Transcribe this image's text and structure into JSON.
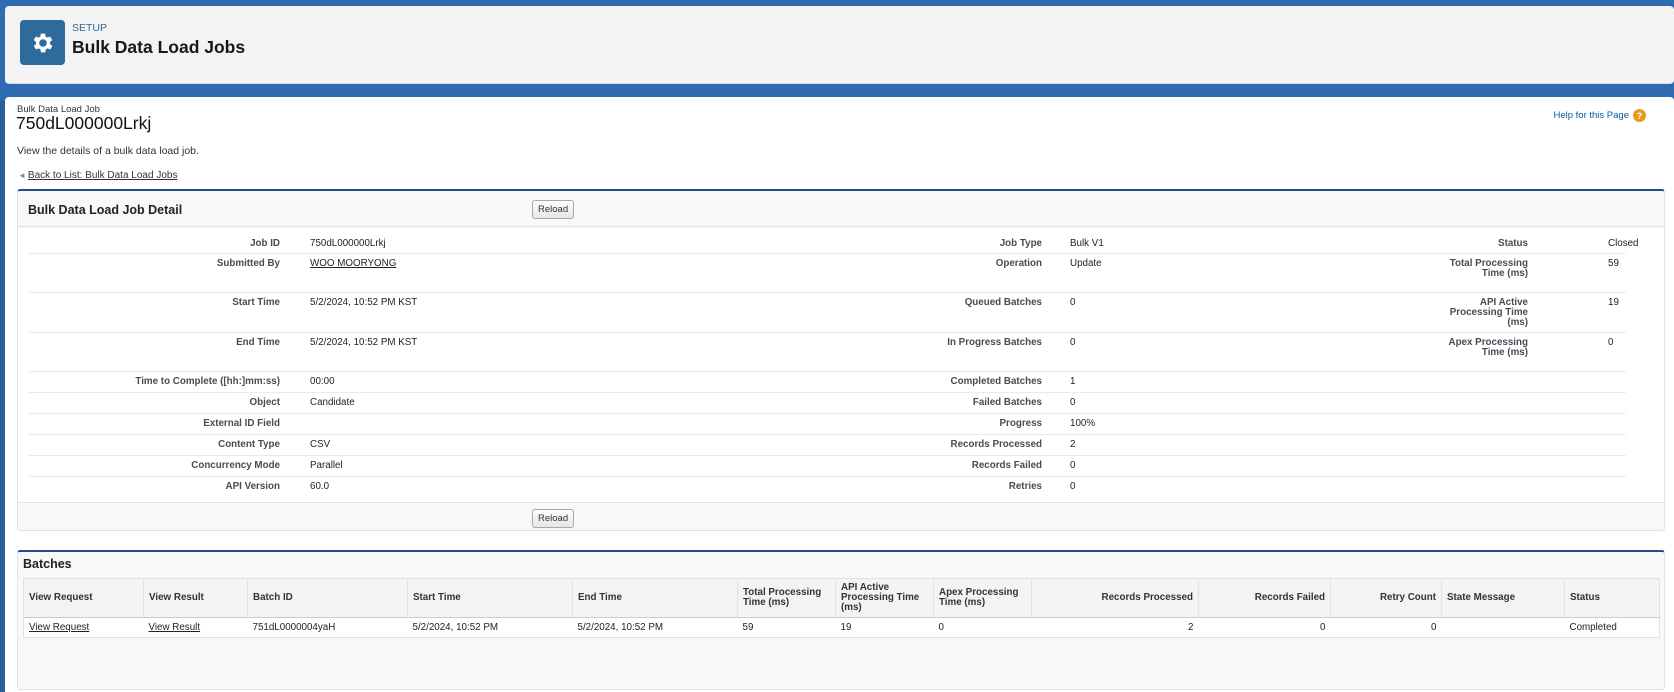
{
  "header": {
    "eyebrow": "SETUP",
    "title": "Bulk Data Load Jobs",
    "icon": "gear-icon"
  },
  "page": {
    "crumb": "Bulk Data Load Job",
    "record_id": "750dL000000Lrkj",
    "description": "View the details of a bulk data load job.",
    "back_link": "Back to List: Bulk Data Load Jobs",
    "help_link": "Help for this Page",
    "help_icon": "?"
  },
  "detail": {
    "title": "Bulk Data Load Job Detail",
    "reload_label": "Reload",
    "rows": [
      {
        "l1": "Job ID",
        "v1": "750dL000000Lrkj",
        "l2": "Job Type",
        "v2": "Bulk V1",
        "l3": "Status",
        "v3": "Closed"
      },
      {
        "l1": "Submitted By",
        "v1": "WOO MOORYONG",
        "l2": "Operation",
        "v2": "Update",
        "l3": "Total Processing Time (ms)",
        "v3": "59"
      },
      {
        "l1": "Start Time",
        "v1": "5/2/2024, 10:52 PM KST",
        "l2": "Queued Batches",
        "v2": "0",
        "l3": "API Active Processing Time (ms)",
        "v3": "19"
      },
      {
        "l1": "End Time",
        "v1": "5/2/2024, 10:52 PM KST",
        "l2": "In Progress Batches",
        "v2": "0",
        "l3": "Apex Processing Time (ms)",
        "v3": "0"
      },
      {
        "l1": "Time to Complete ([hh:]mm:ss)",
        "v1": "00:00",
        "l2": "Completed Batches",
        "v2": "1",
        "l3": "",
        "v3": ""
      },
      {
        "l1": "Object",
        "v1": "Candidate",
        "l2": "Failed Batches",
        "v2": "0",
        "l3": "",
        "v3": ""
      },
      {
        "l1": "External ID Field",
        "v1": "",
        "l2": "Progress",
        "v2": "100%",
        "l3": "",
        "v3": ""
      },
      {
        "l1": "Content Type",
        "v1": "CSV",
        "l2": "Records Processed",
        "v2": "2",
        "l3": "",
        "v3": ""
      },
      {
        "l1": "Concurrency Mode",
        "v1": "Parallel",
        "l2": "Records Failed",
        "v2": "0",
        "l3": "",
        "v3": ""
      },
      {
        "l1": "API Version",
        "v1": "60.0",
        "l2": "Retries",
        "v2": "0",
        "l3": "",
        "v3": ""
      }
    ]
  },
  "batches": {
    "title": "Batches",
    "columns": [
      "View Request",
      "View Result",
      "Batch ID",
      "Start Time",
      "End Time",
      "Total Processing Time (ms)",
      "API Active Processing Time (ms)",
      "Apex Processing Time (ms)",
      "Records Processed",
      "Records Failed",
      "Retry Count",
      "State Message",
      "Status"
    ],
    "rows": [
      [
        "View Request",
        "View Result",
        "751dL0000004yaH",
        "5/2/2024, 10:52 PM",
        "5/2/2024, 10:52 PM",
        "59",
        "19",
        "0",
        "2",
        "0",
        "0",
        "",
        "Completed"
      ]
    ]
  }
}
